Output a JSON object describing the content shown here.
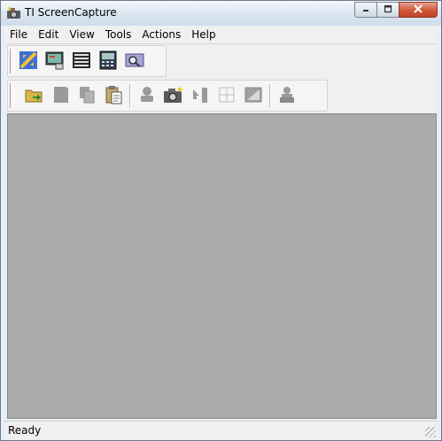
{
  "window": {
    "title": "TI ScreenCapture",
    "app_icon": "camera-app-icon",
    "caption_buttons": [
      "minimize-icon",
      "maximize-icon",
      "close-icon"
    ]
  },
  "menu": {
    "items": [
      "File",
      "Edit",
      "View",
      "Tools",
      "Actions",
      "Help"
    ]
  },
  "toolbar1": {
    "buttons": [
      {
        "icon": "handheld-connect-icon",
        "enabled": true
      },
      {
        "icon": "screen-capture-icon",
        "enabled": true
      },
      {
        "icon": "capture-tiles-icon",
        "enabled": true
      },
      {
        "icon": "calculator-screen-icon",
        "enabled": true
      },
      {
        "icon": "magnify-screen-icon",
        "enabled": true
      }
    ]
  },
  "toolbar2": {
    "buttons": [
      {
        "icon": "open-folder-icon",
        "enabled": true
      },
      {
        "icon": "save-icon",
        "enabled": false
      },
      {
        "icon": "copy-icon",
        "enabled": false
      },
      {
        "icon": "paste-icon",
        "enabled": true
      },
      {
        "icon": "stamp-icon",
        "enabled": false
      },
      {
        "icon": "camera-icon",
        "enabled": true
      },
      {
        "icon": "arrow-insert-icon",
        "enabled": false
      },
      {
        "icon": "grid-icon",
        "enabled": false
      },
      {
        "icon": "border-icon",
        "enabled": false
      },
      {
        "icon": "print-icon",
        "enabled": false
      }
    ]
  },
  "status": {
    "text": "Ready"
  },
  "colors": {
    "client_area": "#ababab",
    "chrome": "#f0f0f0",
    "title_gradient_top": "#f6f9fd",
    "close_red": "#c24125"
  }
}
